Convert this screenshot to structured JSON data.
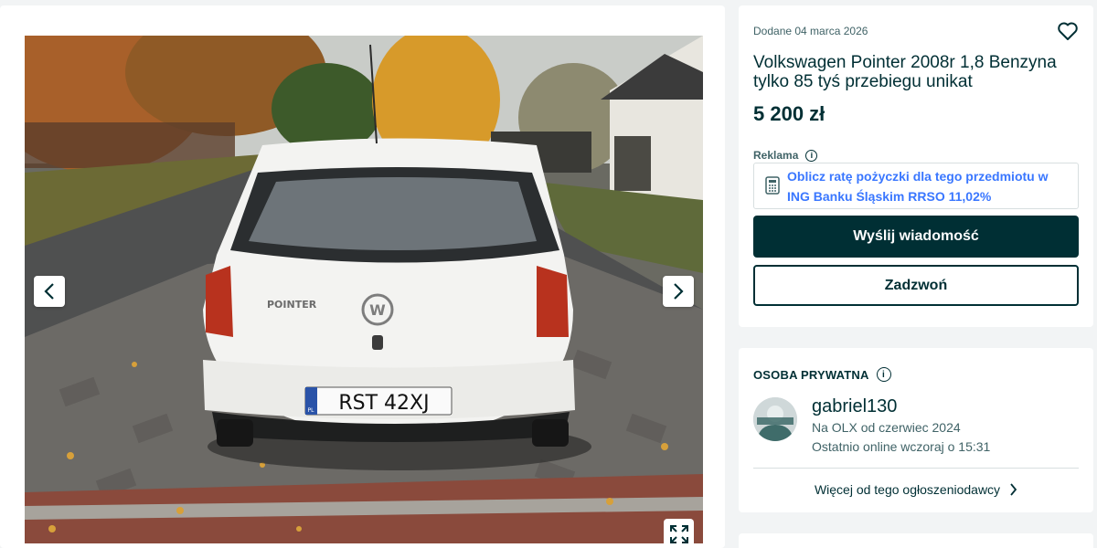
{
  "listing": {
    "added_date": "Dodane 04 marca 2026",
    "title": "Volkswagen Pointer 2008r 1,8 Benzyna tylko 85 tyś przebiegu unikat",
    "price": "5 200 zł"
  },
  "ad": {
    "label": "Reklama",
    "loan_line1": "Oblicz ratę pożyczki dla tego przedmiotu w",
    "loan_line2": "ING Banku Śląskim RRSO 11,02%"
  },
  "actions": {
    "message_label": "Wyślij wiadomość",
    "call_label": "Zadzwoń"
  },
  "seller": {
    "type": "OSOBA PRYWATNA",
    "name": "gabriel130",
    "since": "Na OLX od czerwiec 2024",
    "last_online": "Ostatnio online wczoraj o 15:31",
    "more_link": "Więcej od tego ogłoszeniodawcy"
  },
  "photo": {
    "plate": "RST 42XJ",
    "plate_country": "PL",
    "model_badge": "POINTER",
    "brand_logo": "volkswagen-logo"
  },
  "icons": {
    "favorite": "heart-icon",
    "prev": "chevron-left-icon",
    "next": "chevron-right-icon",
    "expand": "fullscreen-icon",
    "info": "info-icon",
    "calculator": "calculator-icon"
  },
  "colors": {
    "brand_dark": "#002f34",
    "link_blue": "#3a77ff",
    "muted": "#406367",
    "background": "#f2f4f5"
  }
}
